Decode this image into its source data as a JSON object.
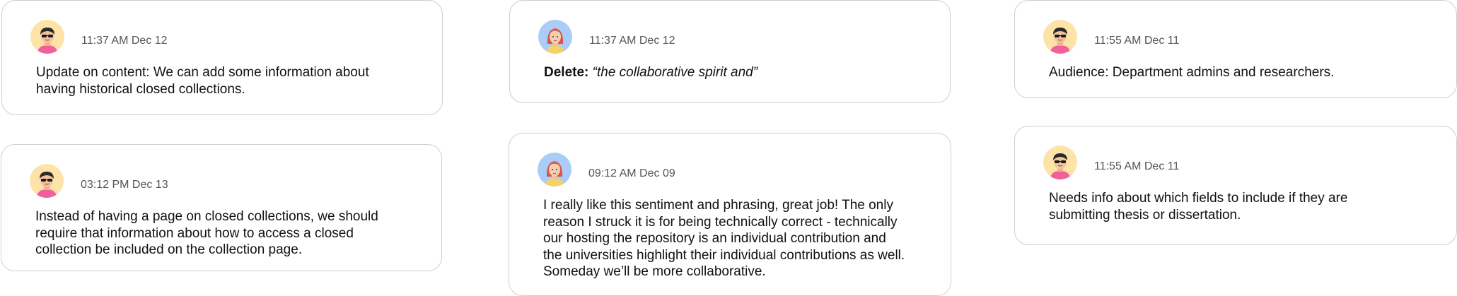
{
  "comments": [
    {
      "avatar": "avatar-sunglasses-icon",
      "timestamp": "11:37 AM Dec 12",
      "lines": [
        "Update on content: We can add some information about",
        "having historical closed collections."
      ]
    },
    {
      "avatar": "avatar-sunglasses-icon",
      "timestamp": "03:12 PM Dec 13",
      "lines": [
        "Instead of having a page on closed collections, we should",
        "require that information about how to access a closed",
        "collection be included on the collection page."
      ]
    },
    {
      "avatar": "avatar-redhair-icon",
      "timestamp": "11:37 AM Dec 12",
      "delete_label": "Delete:",
      "delete_text": "“the collaborative spirit and”"
    },
    {
      "avatar": "avatar-redhair-icon",
      "timestamp": "09:12 AM Dec 09",
      "lines": [
        "I really like this sentiment and phrasing, great job! The only",
        "reason I struck it is for being technically correct - technically",
        "our hosting the repository is an individual contribution and",
        "the universities highlight their individual contributions as well.",
        "Someday we’ll be more collaborative."
      ]
    },
    {
      "avatar": "avatar-sunglasses-icon",
      "timestamp": "11:55 AM Dec 11",
      "lines": [
        "Audience: Department admins and researchers."
      ]
    },
    {
      "avatar": "avatar-sunglasses-icon",
      "timestamp": "11:55 AM Dec 11",
      "lines": [
        "Needs info about which fields to include if they are",
        "submitting thesis or dissertation."
      ]
    }
  ],
  "colors": {
    "card_border": "#cfcfcf",
    "timestamp": "#555555",
    "avatar_yellow_bg": "#fde3a7",
    "avatar_blue_bg": "#a9cdf7"
  }
}
